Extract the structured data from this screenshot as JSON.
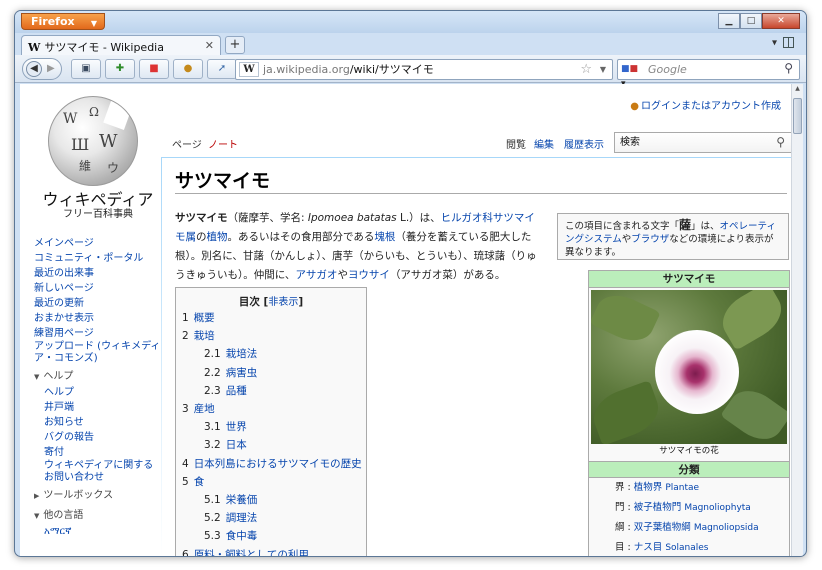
{
  "browser": {
    "app_button": "Firefox",
    "tab_title": "サツマイモ - Wikipedia",
    "tab_icon": "W",
    "new_tab": "+",
    "url_host": "ja.wikipedia.org",
    "url_path": "/wiki/サツマイモ",
    "site_icon": "W",
    "search_placeholder": "Google"
  },
  "wiki": {
    "logo_name": "ウィキペディア",
    "logo_sub": "フリー百科事典",
    "login": "ログインまたはアカウント作成",
    "tabs": {
      "page": "ページ",
      "talk": "ノート",
      "read": "閲覧",
      "edit": "編集",
      "history": "履歴表示"
    },
    "search_value": "検索",
    "sidebar": {
      "main": [
        "メインページ",
        "コミュニティ・ポータル",
        "最近の出来事",
        "新しいページ",
        "最近の更新",
        "おまかせ表示",
        "練習用ページ"
      ],
      "upload": "アップロード (ウィキメディア・コモンズ)",
      "help_heading": "ヘルプ",
      "help": [
        "ヘルプ",
        "井戸端",
        "お知らせ",
        "バグの報告",
        "寄付"
      ],
      "contact": "ウィキペディアに関するお問い合わせ",
      "toolbox": "ツールボックス",
      "languages": "他の言語",
      "lang_first": "አማርኛ"
    },
    "title": "サツマイモ",
    "intro": {
      "p1_bold": "サツマイモ",
      "p1_a": "（薩摩芋、学名: ",
      "p1_sci": "Ipomoea batatas",
      "p1_b": " L.）は、",
      "l1": "ヒルガオ科",
      "l2": "サツマイモ属",
      "p1_c": "の",
      "l3": "植物",
      "p1_d": "。あるいはその食用部分である",
      "l4": "塊根",
      "p1_e": "（養分を蓄えている肥大した根）。別名に、甘藷（かんしょ）、唐芋（からいも、とういも）、琉球藷（りゅうきゅういも）。仲間に、",
      "l5": "アサガオ",
      "p1_f": "や",
      "l6": "ヨウサイ",
      "p1_g": "（アサガオ菜）がある。"
    },
    "note": {
      "a": "この項目に含まれる文字「",
      "char": "薩",
      "b": "」は、",
      "l1": "オペレーティングシステム",
      "c": "や",
      "l2": "ブラウザ",
      "d": "などの環境により表示が異なります。"
    },
    "toc": {
      "title": "目次",
      "hide": "非表示",
      "items": [
        {
          "n": "1",
          "t": "概要",
          "lvl": 1
        },
        {
          "n": "2",
          "t": "栽培",
          "lvl": 1
        },
        {
          "n": "2.1",
          "t": "栽培法",
          "lvl": 2
        },
        {
          "n": "2.2",
          "t": "病害虫",
          "lvl": 2
        },
        {
          "n": "2.3",
          "t": "品種",
          "lvl": 2
        },
        {
          "n": "3",
          "t": "産地",
          "lvl": 1
        },
        {
          "n": "3.1",
          "t": "世界",
          "lvl": 2
        },
        {
          "n": "3.2",
          "t": "日本",
          "lvl": 2
        },
        {
          "n": "4",
          "t": "日本列島におけるサツマイモの歴史",
          "lvl": 1
        },
        {
          "n": "5",
          "t": "食",
          "lvl": 1
        },
        {
          "n": "5.1",
          "t": "栄養価",
          "lvl": 2
        },
        {
          "n": "5.2",
          "t": "調理法",
          "lvl": 2
        },
        {
          "n": "5.3",
          "t": "食中毒",
          "lvl": 2
        },
        {
          "n": "6",
          "t": "原料・飼料としての利用",
          "lvl": 1
        }
      ]
    },
    "infobox": {
      "title": "サツマイモ",
      "caption": "サツマイモの花",
      "section": "分類",
      "rows": [
        {
          "rank": "界",
          "name": "植物界",
          "latin": "Plantae"
        },
        {
          "rank": "門",
          "name": "被子植物門",
          "latin": "Magnoliophyta"
        },
        {
          "rank": "綱",
          "name": "双子葉植物綱",
          "latin": "Magnoliopsida"
        },
        {
          "rank": "目",
          "name": "ナス目",
          "latin": "Solanales"
        }
      ]
    }
  }
}
